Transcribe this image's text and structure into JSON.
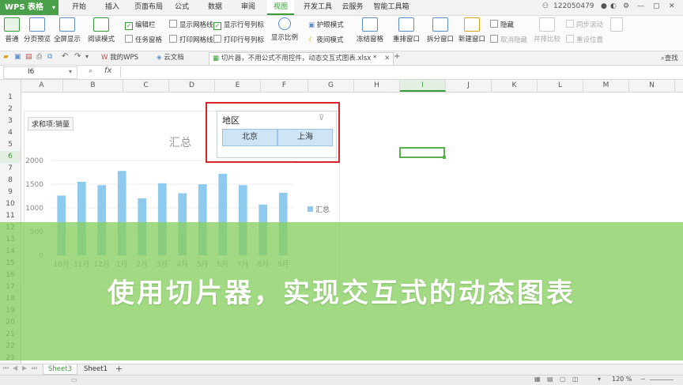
{
  "menubar": {
    "app_button": "WPS 表格",
    "tabs": [
      "开始",
      "插入",
      "页面布局",
      "公式",
      "数据",
      "审阅",
      "视图",
      "开发工具",
      "云服务",
      "智能工具箱"
    ],
    "active_tab": "视图",
    "user_id": "122050479"
  },
  "ribbon": {
    "normal": "普通",
    "page_break": "分页预览",
    "fullscreen": "全屏显示",
    "reading_mode": "阅读模式",
    "edit_bar": "编辑栏",
    "task_pane": "任务窗格",
    "show_gridlines": "显示网格线",
    "print_gridlines": "打印网格线",
    "show_headers": "显示行号列标",
    "print_headers": "打印行号列标",
    "zoom": "显示比例",
    "eye_mode": "护眼模式",
    "night_mode": "夜间模式",
    "freeze": "冻结窗格",
    "arrange": "重排窗口",
    "split": "拆分窗口",
    "new_window": "新建窗口",
    "hide": "隐藏",
    "unhide": "取消隐藏",
    "side_by_side": "并排比较",
    "sync_scroll": "同步滚动",
    "reset_pos": "重设位置"
  },
  "docbar": {
    "tab_mywps": "我的WPS",
    "tab_cloud": "云文档",
    "tab_file": "切片器，不用公式不用控件，动态交互式图表.xlsx *",
    "search": "查找"
  },
  "formula": {
    "cell_ref": "I6",
    "fx": "fx"
  },
  "columns": [
    "A",
    "B",
    "C",
    "D",
    "E",
    "F",
    "G",
    "H",
    "I",
    "J",
    "K",
    "L",
    "M",
    "N"
  ],
  "selected_column": "I",
  "rows": [
    "1",
    "2",
    "3",
    "4",
    "5",
    "6",
    "7",
    "8",
    "9",
    "10",
    "11",
    "12",
    "13",
    "14",
    "15",
    "16",
    "17",
    "18",
    "19",
    "20",
    "21",
    "22",
    "23"
  ],
  "pivot_field_label": "求和项:销量",
  "chart_data": {
    "type": "bar",
    "title": "汇总",
    "categories": [
      "10月",
      "11月",
      "12月",
      "1月",
      "2月",
      "3月",
      "4月",
      "5月",
      "6月",
      "7月",
      "8月",
      "9月"
    ],
    "series": [
      {
        "name": "汇总",
        "values": [
          1260,
          1550,
          1480,
          1780,
          1200,
          1520,
          1310,
          1500,
          1720,
          1480,
          1070,
          1320
        ]
      }
    ],
    "ylim": [
      0,
      2000
    ],
    "yticks": [
      0,
      500,
      1000,
      1500,
      2000
    ],
    "bar_color": "#8ec9ee",
    "legend_position": "right"
  },
  "slicer": {
    "title": "地区",
    "items": [
      "北京",
      "上海"
    ]
  },
  "banner": {
    "text": "使用切片器，实现交互式的动态图表",
    "color": "#87d05f"
  },
  "sheets": [
    "Sheet3",
    "Sheet1"
  ],
  "active_sheet": "Sheet3",
  "status": {
    "zoom": "120 %"
  }
}
